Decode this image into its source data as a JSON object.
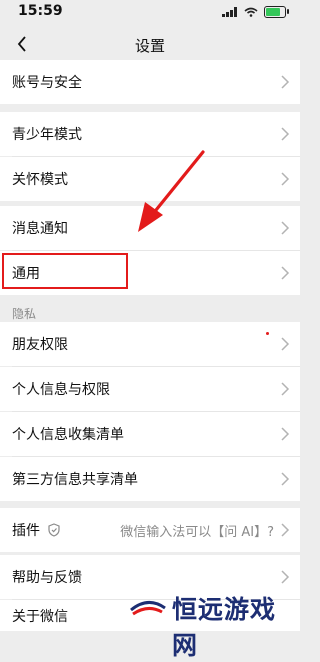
{
  "status": {
    "time": "15:59"
  },
  "nav": {
    "title": "设置"
  },
  "items": {
    "account": "账号与安全",
    "youth": "青少年模式",
    "care": "关怀模式",
    "notifications": "消息通知",
    "general": "通用",
    "friend_permissions": "朋友权限",
    "personal_info": "个人信息与权限",
    "info_collection": "个人信息收集清单",
    "third_party": "第三方信息共享清单",
    "plugins": "插件",
    "plugins_value": "微信输入法可以【问 AI】?",
    "help": "帮助与反馈",
    "about": "关于微信"
  },
  "sections": {
    "privacy": "隐私"
  },
  "watermark": {
    "text": "恒远游戏网"
  },
  "icons": [
    "back-icon",
    "chevron-right-icon",
    "shield-icon",
    "wifi-icon",
    "signal-icon",
    "battery-icon"
  ],
  "colors": {
    "accent": "#e31b1b",
    "background": "#ededed",
    "row": "#ffffff",
    "secondary_text": "#8a8a8a"
  }
}
